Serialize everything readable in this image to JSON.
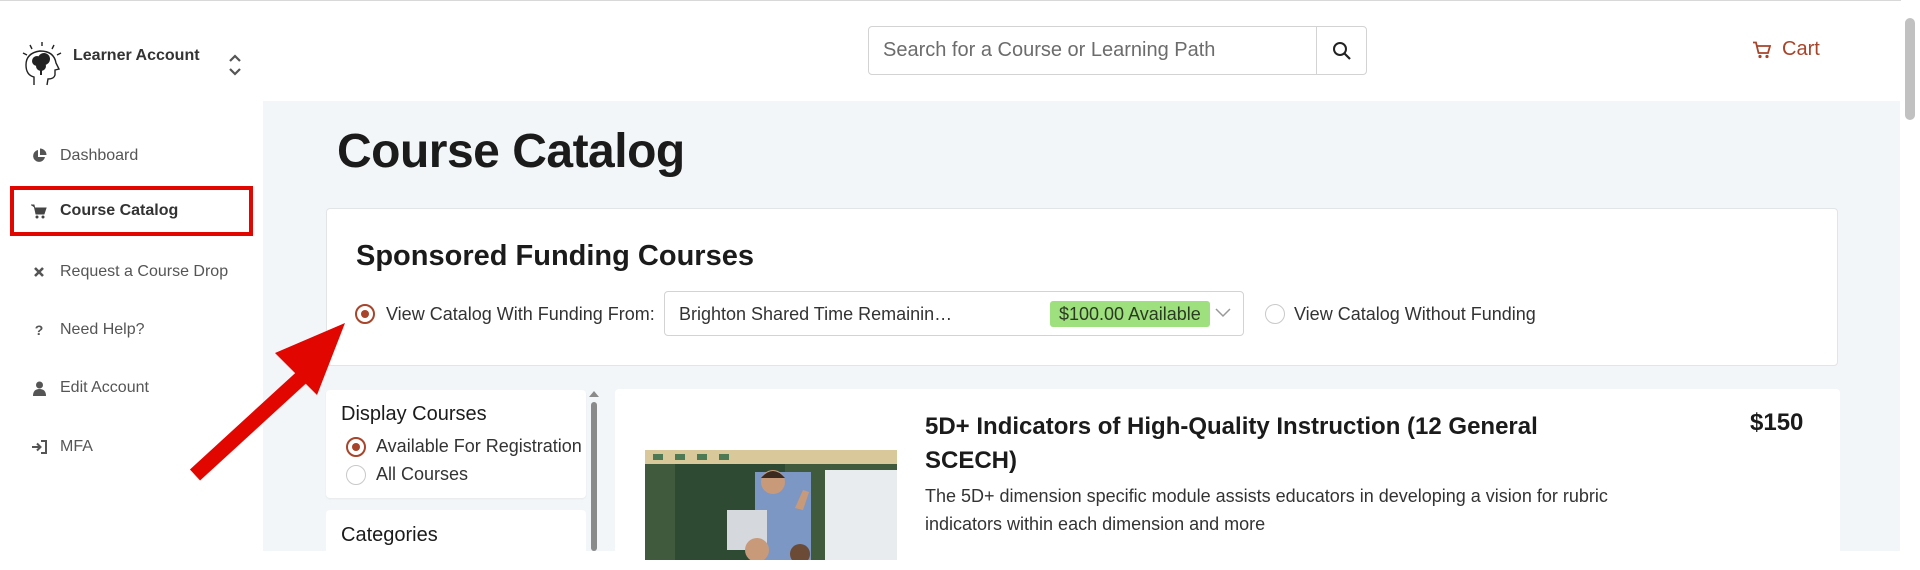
{
  "account": {
    "label": "Learner Account"
  },
  "sidebar": {
    "items": [
      {
        "label": "Dashboard",
        "icon": "pie-chart-icon"
      },
      {
        "label": "Course Catalog",
        "icon": "cart-icon",
        "active": true
      },
      {
        "label": "Request a Course Drop",
        "icon": "x-icon"
      },
      {
        "label": "Need Help?",
        "icon": "question-icon"
      },
      {
        "label": "Edit Account",
        "icon": "user-icon"
      },
      {
        "label": "MFA",
        "icon": "sign-in-icon"
      }
    ]
  },
  "header": {
    "search_placeholder": "Search for a Course or Learning Path",
    "cart_label": "Cart"
  },
  "page": {
    "title": "Course Catalog"
  },
  "funding": {
    "title": "Sponsored Funding Courses",
    "with_label": "View Catalog With Funding From:",
    "selected_source": "Brighton Shared Time Remainin…",
    "available_badge": "$100.00 Available",
    "without_label": "View Catalog Without Funding"
  },
  "filters": {
    "display_heading": "Display Courses",
    "options": [
      "Available For Registration",
      "All Courses"
    ],
    "categories_heading": "Categories"
  },
  "course": {
    "title": "5D+ Indicators of High-Quality Instruction (12 General SCECH)",
    "description": "The 5D+ dimension specific module assists educators in developing a vision for rubric indicators within each dimension and more",
    "price": "$150"
  },
  "colors": {
    "accent": "#a8442a",
    "badge": "#9ee07e",
    "highlight": "#e10600",
    "main_bg": "#f3f6f8"
  }
}
